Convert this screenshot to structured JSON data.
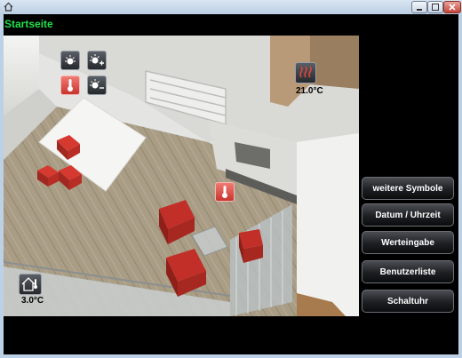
{
  "window": {
    "icons": {
      "app": "home-icon",
      "minimize": "minimize-icon",
      "maximize": "maximize-icon",
      "close": "close-icon"
    }
  },
  "page": {
    "title": "Startseite"
  },
  "floorplan": {
    "controls": [
      {
        "name": "light-dimmer-icon",
        "active": false
      },
      {
        "name": "light-brighter-icon",
        "active": false
      },
      {
        "name": "thermometer-icon",
        "active": true
      },
      {
        "name": "light-darker-icon",
        "active": false
      }
    ],
    "heater": {
      "icon": "heater-icon",
      "temperature": "21.0°C"
    },
    "room_thermo": {
      "icon": "thermometer-icon"
    },
    "outdoor": {
      "icon": "house-thermometer-icon",
      "temperature": "3.0°C"
    }
  },
  "sidebar": {
    "buttons": [
      {
        "label": "weitere Symbole"
      },
      {
        "label": "Datum / Uhrzeit"
      },
      {
        "label": "Werteingabe"
      },
      {
        "label": "Benutzerliste"
      },
      {
        "label": "Schaltuhr"
      }
    ]
  },
  "colors": {
    "title": "#22e04a",
    "active_tile": "#d8403a",
    "background": "#000000"
  }
}
